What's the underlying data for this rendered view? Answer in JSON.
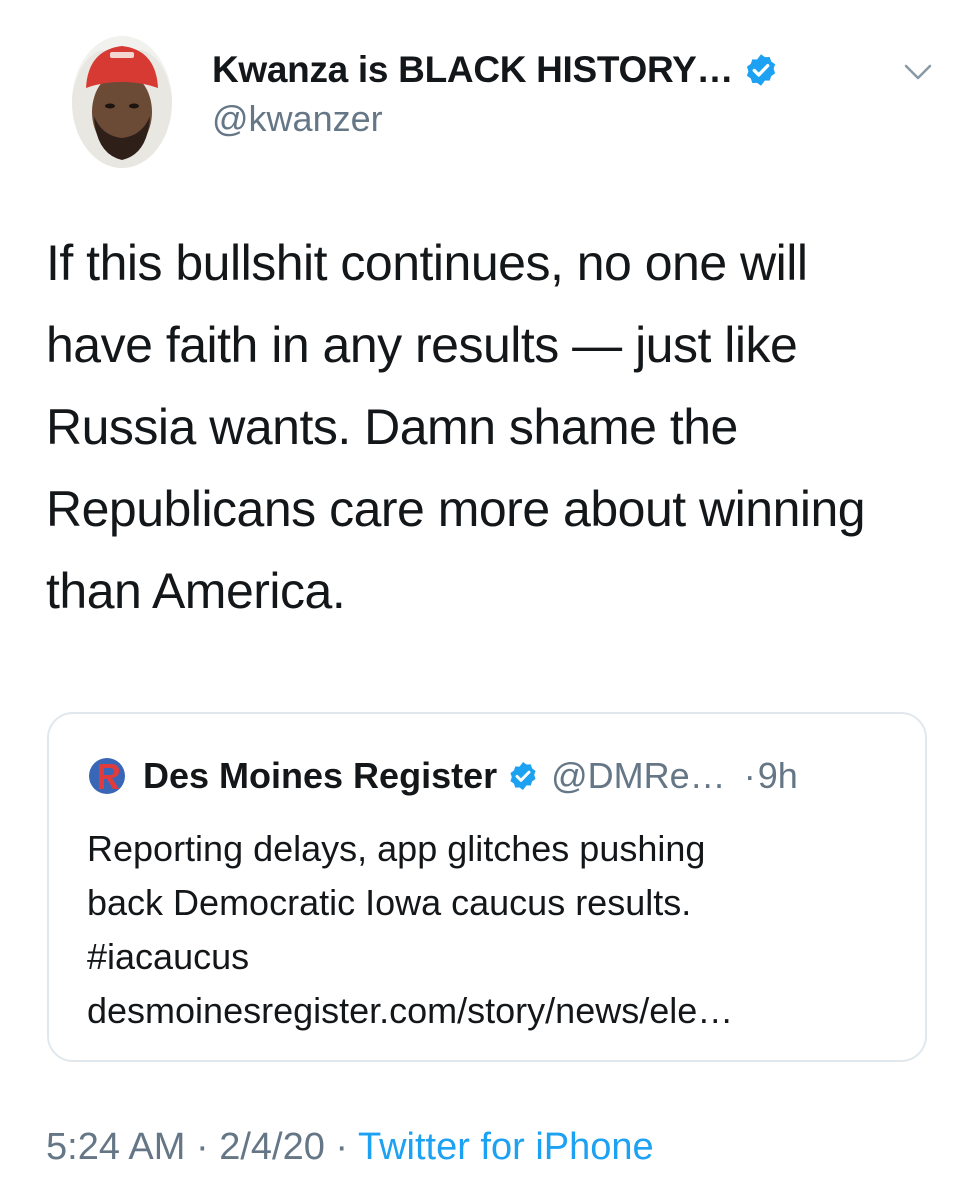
{
  "tweet": {
    "author": {
      "display_name": "Kwanza is BLACK HISTORY…",
      "handle": "@kwanzer",
      "verified_icon": "verified-badge-icon",
      "avatar": "profile-photo"
    },
    "menu_icon": "chevron-down-icon",
    "text": "If this bullshit continues, no one will have faith in any results — just like Russia wants. Damn shame the Republicans care more about winning than America.",
    "quoted": {
      "display_name": "Des Moines Register",
      "handle": "@DMRe…",
      "separator": "·",
      "time": "9h",
      "text_lines": [
        "Reporting delays, app glitches pushing",
        "back Democratic Iowa caucus results.",
        "#iacaucus",
        "desmoinesregister.com/story/news/ele…"
      ]
    },
    "meta": {
      "time": "5:24 AM",
      "sep1": " · ",
      "date": "2/4/20",
      "sep2": " · ",
      "source": "Twitter for iPhone"
    }
  },
  "colors": {
    "text": "#14171a",
    "secondary": "#657786",
    "link": "#1da1f2",
    "verified": "#1da1f2",
    "border": "#e1e8ed"
  }
}
